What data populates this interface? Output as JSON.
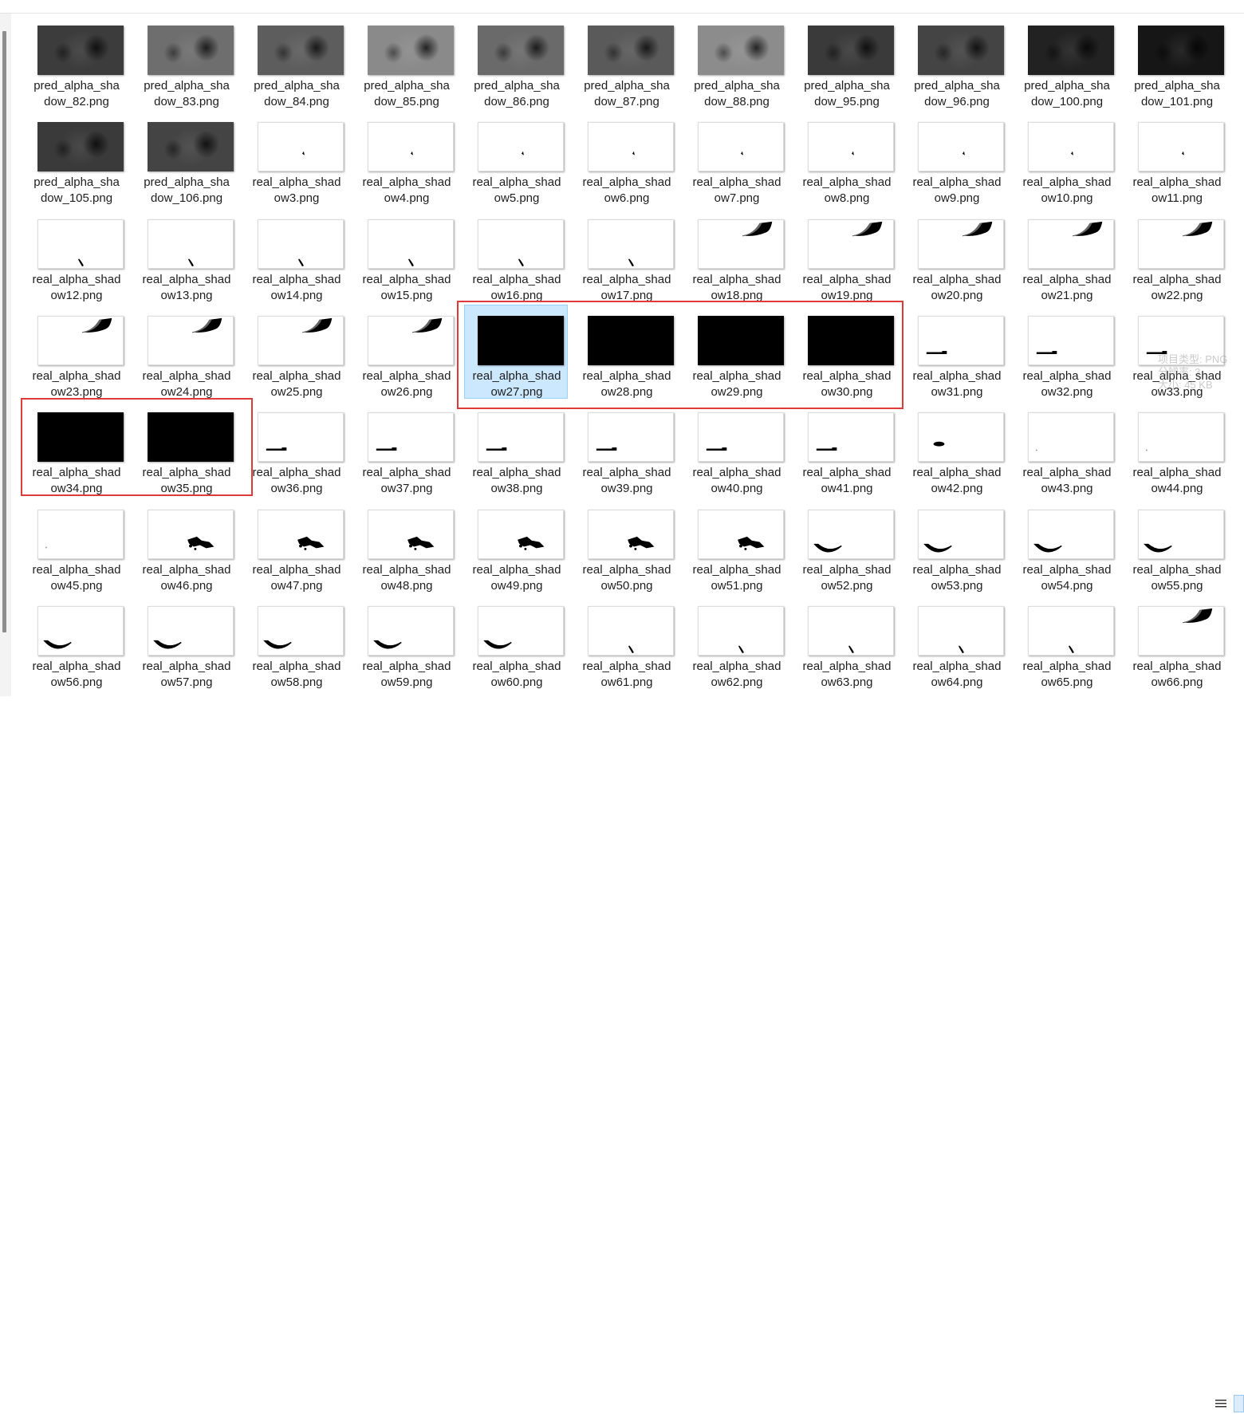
{
  "explorer": {
    "files": [
      {
        "name": "pred_alpha_sha\ndow_82.png",
        "thumb": "gray",
        "tone": "#3c3c3c"
      },
      {
        "name": "pred_alpha_sha\ndow_83.png",
        "thumb": "gray",
        "tone": "#6e6e6e"
      },
      {
        "name": "pred_alpha_sha\ndow_84.png",
        "thumb": "gray",
        "tone": "#5d5d5d"
      },
      {
        "name": "pred_alpha_sha\ndow_85.png",
        "thumb": "gray",
        "tone": "#8a8a8a"
      },
      {
        "name": "pred_alpha_sha\ndow_86.png",
        "thumb": "gray",
        "tone": "#6a6a6a"
      },
      {
        "name": "pred_alpha_sha\ndow_87.png",
        "thumb": "gray",
        "tone": "#5a5a5a"
      },
      {
        "name": "pred_alpha_sha\ndow_88.png",
        "thumb": "gray",
        "tone": "#8c8c8c"
      },
      {
        "name": "pred_alpha_sha\ndow_95.png",
        "thumb": "gray",
        "tone": "#3a3a3a"
      },
      {
        "name": "pred_alpha_sha\ndow_96.png",
        "thumb": "gray",
        "tone": "#444444"
      },
      {
        "name": "pred_alpha_sha\ndow_100.png",
        "thumb": "gray",
        "tone": "#222222"
      },
      {
        "name": "pred_alpha_sha\ndow_101.png",
        "thumb": "gray",
        "tone": "#161616"
      },
      {
        "name": "pred_alpha_sha\ndow_105.png",
        "thumb": "gray",
        "tone": "#3a3a3a"
      },
      {
        "name": "pred_alpha_sha\ndow_106.png",
        "thumb": "gray",
        "tone": "#444444"
      },
      {
        "name": "real_alpha_shad\now3.png",
        "thumb": "white",
        "shape": "tick"
      },
      {
        "name": "real_alpha_shad\now4.png",
        "thumb": "white",
        "shape": "tick"
      },
      {
        "name": "real_alpha_shad\now5.png",
        "thumb": "white",
        "shape": "tick"
      },
      {
        "name": "real_alpha_shad\now6.png",
        "thumb": "white",
        "shape": "tick"
      },
      {
        "name": "real_alpha_shad\now7.png",
        "thumb": "white",
        "shape": "tick"
      },
      {
        "name": "real_alpha_shad\now8.png",
        "thumb": "white",
        "shape": "tick"
      },
      {
        "name": "real_alpha_shad\now9.png",
        "thumb": "white",
        "shape": "tick"
      },
      {
        "name": "real_alpha_shad\now10.png",
        "thumb": "white",
        "shape": "tick"
      },
      {
        "name": "real_alpha_shad\now11.png",
        "thumb": "white",
        "shape": "tick"
      },
      {
        "name": "real_alpha_shad\now12.png",
        "thumb": "white",
        "shape": "stroke"
      },
      {
        "name": "real_alpha_shad\now13.png",
        "thumb": "white",
        "shape": "stroke"
      },
      {
        "name": "real_alpha_shad\now14.png",
        "thumb": "white",
        "shape": "stroke"
      },
      {
        "name": "real_alpha_shad\now15.png",
        "thumb": "white",
        "shape": "stroke"
      },
      {
        "name": "real_alpha_shad\now16.png",
        "thumb": "white",
        "shape": "stroke"
      },
      {
        "name": "real_alpha_shad\now17.png",
        "thumb": "white",
        "shape": "stroke"
      },
      {
        "name": "real_alpha_shad\now18.png",
        "thumb": "white",
        "shape": "wing"
      },
      {
        "name": "real_alpha_shad\now19.png",
        "thumb": "white",
        "shape": "wing"
      },
      {
        "name": "real_alpha_shad\now20.png",
        "thumb": "white",
        "shape": "wing"
      },
      {
        "name": "real_alpha_shad\now21.png",
        "thumb": "white",
        "shape": "wing"
      },
      {
        "name": "real_alpha_shad\now22.png",
        "thumb": "white",
        "shape": "wing"
      },
      {
        "name": "real_alpha_shad\now23.png",
        "thumb": "white",
        "shape": "wing"
      },
      {
        "name": "real_alpha_shad\now24.png",
        "thumb": "white",
        "shape": "wing"
      },
      {
        "name": "real_alpha_shad\now25.png",
        "thumb": "white",
        "shape": "wing"
      },
      {
        "name": "real_alpha_shad\now26.png",
        "thumb": "white",
        "shape": "wing"
      },
      {
        "name": "real_alpha_shad\now27.png",
        "thumb": "black",
        "selected": true
      },
      {
        "name": "real_alpha_shad\now28.png",
        "thumb": "black"
      },
      {
        "name": "real_alpha_shad\now29.png",
        "thumb": "black"
      },
      {
        "name": "real_alpha_shad\now30.png",
        "thumb": "black"
      },
      {
        "name": "real_alpha_shad\now31.png",
        "thumb": "white",
        "shape": "bar"
      },
      {
        "name": "real_alpha_shad\now32.png",
        "thumb": "white",
        "shape": "bar"
      },
      {
        "name": "real_alpha_shad\now33.png",
        "thumb": "white",
        "shape": "bar"
      },
      {
        "name": "real_alpha_shad\now34.png",
        "thumb": "black"
      },
      {
        "name": "real_alpha_shad\now35.png",
        "thumb": "black"
      },
      {
        "name": "real_alpha_shad\now36.png",
        "thumb": "white",
        "shape": "bar"
      },
      {
        "name": "real_alpha_shad\now37.png",
        "thumb": "white",
        "shape": "bar"
      },
      {
        "name": "real_alpha_shad\now38.png",
        "thumb": "white",
        "shape": "bar"
      },
      {
        "name": "real_alpha_shad\now39.png",
        "thumb": "white",
        "shape": "bar"
      },
      {
        "name": "real_alpha_shad\now40.png",
        "thumb": "white",
        "shape": "bar"
      },
      {
        "name": "real_alpha_shad\now41.png",
        "thumb": "white",
        "shape": "bar"
      },
      {
        "name": "real_alpha_shad\now42.png",
        "thumb": "white",
        "shape": "blob"
      },
      {
        "name": "real_alpha_shad\now43.png",
        "thumb": "white",
        "shape": "dot"
      },
      {
        "name": "real_alpha_shad\now44.png",
        "thumb": "white",
        "shape": "dot"
      },
      {
        "name": "real_alpha_shad\now45.png",
        "thumb": "white",
        "shape": "dot"
      },
      {
        "name": "real_alpha_shad\now46.png",
        "thumb": "white",
        "shape": "splat"
      },
      {
        "name": "real_alpha_shad\now47.png",
        "thumb": "white",
        "shape": "splat"
      },
      {
        "name": "real_alpha_shad\now48.png",
        "thumb": "white",
        "shape": "splat"
      },
      {
        "name": "real_alpha_shad\now49.png",
        "thumb": "white",
        "shape": "splat"
      },
      {
        "name": "real_alpha_shad\now50.png",
        "thumb": "white",
        "shape": "splat"
      },
      {
        "name": "real_alpha_shad\now51.png",
        "thumb": "white",
        "shape": "splat"
      },
      {
        "name": "real_alpha_shad\now52.png",
        "thumb": "white",
        "shape": "arc"
      },
      {
        "name": "real_alpha_shad\now53.png",
        "thumb": "white",
        "shape": "arc"
      },
      {
        "name": "real_alpha_shad\now54.png",
        "thumb": "white",
        "shape": "arc"
      },
      {
        "name": "real_alpha_shad\now55.png",
        "thumb": "white",
        "shape": "arc"
      },
      {
        "name": "real_alpha_shad\now56.png",
        "thumb": "white",
        "shape": "arc"
      },
      {
        "name": "real_alpha_shad\now57.png",
        "thumb": "white",
        "shape": "arc"
      },
      {
        "name": "real_alpha_shad\now58.png",
        "thumb": "white",
        "shape": "arc"
      },
      {
        "name": "real_alpha_shad\now59.png",
        "thumb": "white",
        "shape": "arc"
      },
      {
        "name": "real_alpha_shad\now60.png",
        "thumb": "white",
        "shape": "arc"
      },
      {
        "name": "real_alpha_shad\now61.png",
        "thumb": "white",
        "shape": "stroke"
      },
      {
        "name": "real_alpha_shad\now62.png",
        "thumb": "white",
        "shape": "stroke"
      },
      {
        "name": "real_alpha_shad\now63.png",
        "thumb": "white",
        "shape": "stroke"
      },
      {
        "name": "real_alpha_shad\now64.png",
        "thumb": "white",
        "shape": "stroke"
      },
      {
        "name": "real_alpha_shad\now65.png",
        "thumb": "white",
        "shape": "stroke"
      },
      {
        "name": "real_alpha_shad\now66.png",
        "thumb": "white",
        "shape": "wing"
      }
    ]
  },
  "tooltip": {
    "line1": "项目类型: PNG",
    "line2": "分辨率: 3",
    "line3": "大小: 45 KB"
  },
  "status_bar": {
    "details_view_icon": "list-lines-icon",
    "large_icons_view_icon": "tiles-icon"
  },
  "colors": {
    "selection_fill": "#cce8ff",
    "selection_border": "#99d1ff",
    "annotation_red": "#e03b3b"
  }
}
